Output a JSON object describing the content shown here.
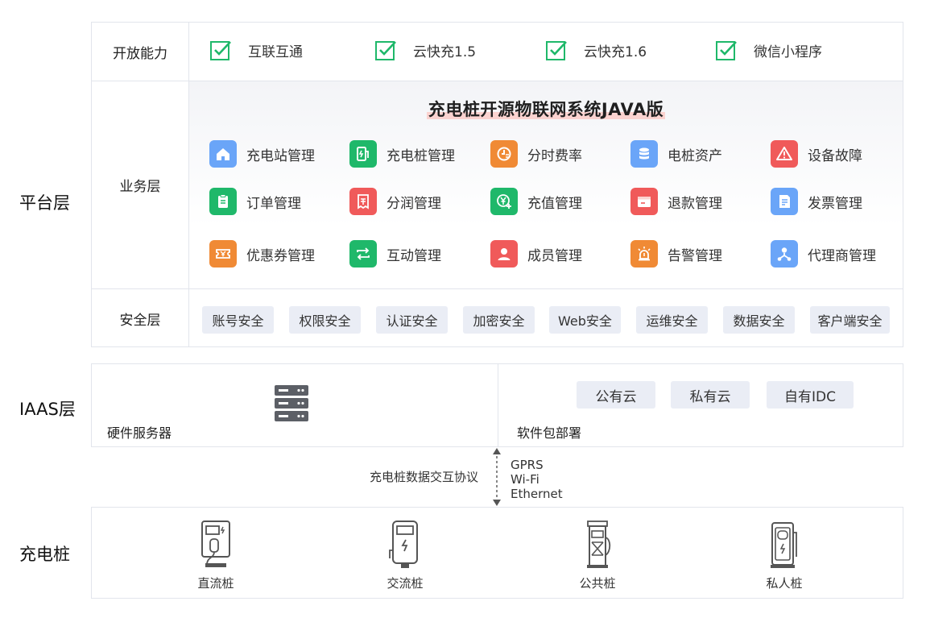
{
  "layers": {
    "platform": "平台层",
    "iaas": "IAAS层",
    "charger": "充电桩"
  },
  "open_capability": {
    "label": "开放能力",
    "items": [
      "互联互通",
      "云快充1.5",
      "云快充1.6",
      "微信小程序"
    ]
  },
  "business": {
    "label": "业务层",
    "title": "充电桩开源物联网系统JAVA版",
    "items": [
      {
        "label": "充电站管理",
        "icon": "home-icon",
        "color": "#6aa5f8"
      },
      {
        "label": "充电桩管理",
        "icon": "charger-pump-icon",
        "color": "#1fb86a"
      },
      {
        "label": "分时费率",
        "icon": "clock-rate-icon",
        "color": "#f08a35"
      },
      {
        "label": "电桩资产",
        "icon": "database-icon",
        "color": "#6aa5f8"
      },
      {
        "label": "设备故障",
        "icon": "warning-icon",
        "color": "#f05a5a"
      },
      {
        "label": "订单管理",
        "icon": "clipboard-icon",
        "color": "#1fb86a"
      },
      {
        "label": "分润管理",
        "icon": "receipt-icon",
        "color": "#f05a5a"
      },
      {
        "label": "充值管理",
        "icon": "yen-plus-icon",
        "color": "#1fb86a"
      },
      {
        "label": "退款管理",
        "icon": "wallet-icon",
        "color": "#f05a5a"
      },
      {
        "label": "发票管理",
        "icon": "invoice-icon",
        "color": "#6aa5f8"
      },
      {
        "label": "优惠券管理",
        "icon": "coupon-icon",
        "color": "#f08a35"
      },
      {
        "label": "互动管理",
        "icon": "swap-icon",
        "color": "#1fb86a"
      },
      {
        "label": "成员管理",
        "icon": "user-icon",
        "color": "#f05a5a"
      },
      {
        "label": "告警管理",
        "icon": "alarm-light-icon",
        "color": "#f08a35"
      },
      {
        "label": "代理商管理",
        "icon": "network-user-icon",
        "color": "#6aa5f8"
      }
    ]
  },
  "security": {
    "label": "安全层",
    "items": [
      "账号安全",
      "权限安全",
      "认证安全",
      "加密安全",
      "Web安全",
      "运维安全",
      "数据安全",
      "客户端安全"
    ]
  },
  "iaas": {
    "hardware": "硬件服务器",
    "software": "软件包部署",
    "clouds": [
      "公有云",
      "私有云",
      "自有IDC"
    ]
  },
  "protocol": {
    "label": "充电桩数据交互协议",
    "lines": [
      "GPRS",
      "Wi-Fi",
      "Ethernet"
    ]
  },
  "chargers": [
    "直流桩",
    "交流桩",
    "公共桩",
    "私人桩"
  ],
  "colors": {
    "check": "#1fb86a",
    "border": "#e2e5ec",
    "tag_bg": "#eaedf5",
    "title_highlight": "#fbd3d0"
  }
}
